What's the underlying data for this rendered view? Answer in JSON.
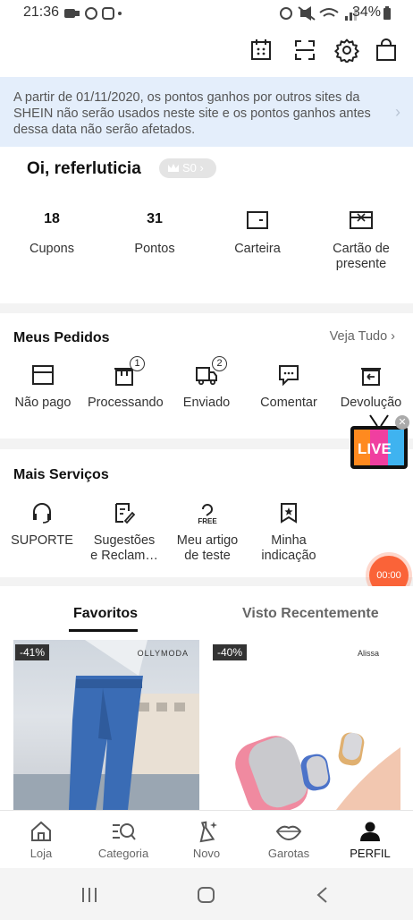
{
  "status_bar": {
    "time": "21:36",
    "battery": "34%"
  },
  "notice": {
    "text": "A partir de 01/11/2020, os pontos ganhos por outros sites da SHEIN não serão usados neste site e os pontos ganhos antes dessa data não serão afetados."
  },
  "profile": {
    "greeting": "Oi, referluticia",
    "vip_level": "S0",
    "stats": [
      {
        "value": "18",
        "label": "Cupons"
      },
      {
        "value": "31",
        "label": "Pontos"
      },
      {
        "label": "Carteira"
      },
      {
        "label": "Cartão de presente"
      }
    ]
  },
  "orders": {
    "title": "Meus Pedidos",
    "view_all": "Veja Tudo",
    "items": [
      {
        "label": "Não pago"
      },
      {
        "label": "Processando",
        "badge": "1"
      },
      {
        "label": "Enviado",
        "badge": "2"
      },
      {
        "label": "Comentar"
      },
      {
        "label": "Devolução"
      }
    ]
  },
  "services": {
    "title": "Mais Serviços",
    "items": [
      {
        "label": "SUPORTE"
      },
      {
        "label": "Sugestões e Reclam…"
      },
      {
        "label": "Meu artigo de teste"
      },
      {
        "label": "Minha indicação"
      }
    ]
  },
  "live_badge": "LIVE",
  "timer": "00:00",
  "tabs": [
    {
      "label": "Favoritos",
      "active": true
    },
    {
      "label": "Visto Recentemente",
      "active": false
    }
  ],
  "products": [
    {
      "discount": "-41%",
      "brand": "OLLYMODA"
    },
    {
      "discount": "-40%",
      "brand": "Alissa"
    }
  ],
  "bottom_nav": [
    {
      "label": "Loja"
    },
    {
      "label": "Categoria"
    },
    {
      "label": "Novo"
    },
    {
      "label": "Garotas"
    },
    {
      "label": "PERFIL",
      "active": true
    }
  ],
  "colors": {
    "accent": "#fa6338",
    "notice_bg": "#e4eefb"
  }
}
